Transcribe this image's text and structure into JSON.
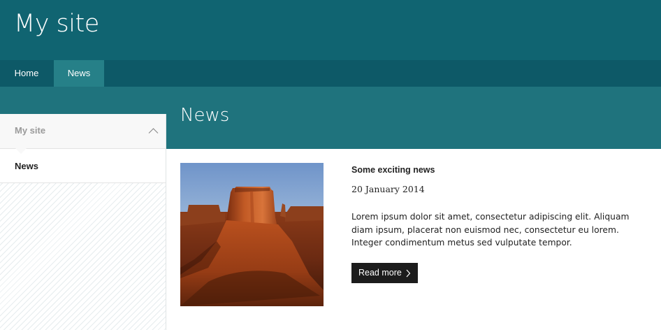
{
  "header": {
    "site_title": "My site"
  },
  "nav": {
    "items": [
      {
        "label": "Home",
        "active": false
      },
      {
        "label": "News",
        "active": true
      }
    ]
  },
  "page": {
    "title": "News"
  },
  "sidebar": {
    "header_label": "My site",
    "header_icon": "chevron-up-icon",
    "items": [
      {
        "label": "News"
      }
    ]
  },
  "article": {
    "image_alt": "",
    "title": "Some exciting news",
    "date": "20 January 2014",
    "body": "Lorem ipsum dolor sit amet, consectetur adipiscing elit. Aliquam diam ipsum, placerat non euismod nec, consectetur eu lorem. Integer condimentum metus sed vulputate tempor.",
    "read_more_label": "Read more",
    "read_more_icon": "chevron-right-icon"
  },
  "colors": {
    "header_bg": "#106471",
    "nav_bg": "#0d5967",
    "nav_active_bg": "#268088",
    "band_bg": "#1f737d",
    "button_bg": "#1c1c1c"
  }
}
